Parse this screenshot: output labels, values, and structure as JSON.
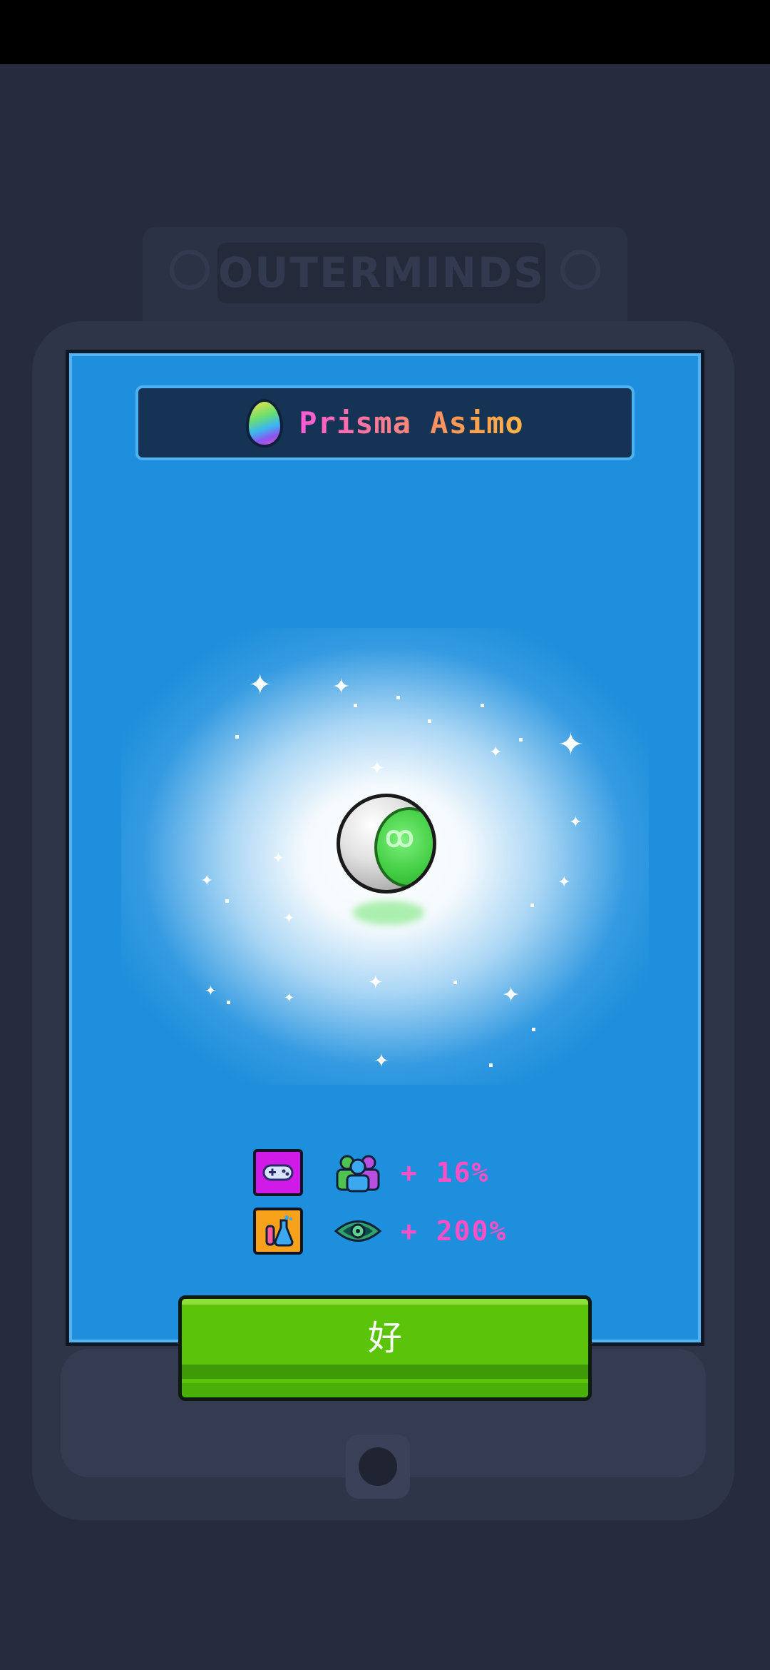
{
  "background_machine": {
    "logo_text": "OUTERMINDS"
  },
  "reward": {
    "title": "Prisma Asimo",
    "title_icon": "rainbow-egg-icon",
    "item_icon": "alien-orb-icon"
  },
  "bonuses": [
    {
      "category_icon": "gamepad-icon",
      "stat_icon": "people-icon",
      "value": "+ 16%"
    },
    {
      "category_icon": "lab-flask-icon",
      "stat_icon": "eye-icon",
      "value": "+ 200%"
    }
  ],
  "ok_button": {
    "label": "好"
  },
  "colors": {
    "card_blue": "#1e8fdc",
    "title_bar": "#153355",
    "button_green": "#5bc40a",
    "bonus_text": "#ff4fc7",
    "backdrop": "#262b3d"
  }
}
